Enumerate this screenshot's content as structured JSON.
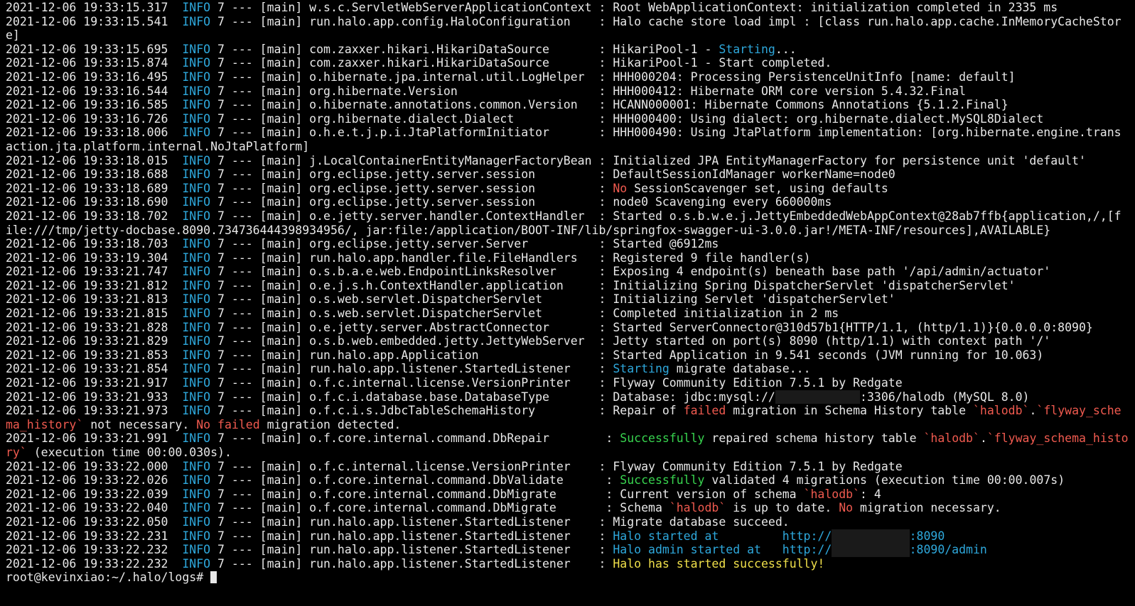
{
  "colors": {
    "background": "#000000",
    "text": "#e8e8e8",
    "info": "#2ea8dc",
    "error": "#f05a4f",
    "success": "#38d44f",
    "highlight": "#f0e04a"
  },
  "lines": [
    [
      {
        "t": "2021-12-06 19:33:15.317  "
      },
      {
        "t": "INFO",
        "c": "cyan"
      },
      {
        "t": " 7 --- [main] w.s.c.ServletWebServerApplicationContext : Root WebApplicationContext: initialization completed in 2335 ms"
      }
    ],
    [
      {
        "t": "2021-12-06 19:33:15.541  "
      },
      {
        "t": "INFO",
        "c": "cyan"
      },
      {
        "t": " 7 --- [main] run.halo.app.config.HaloConfiguration    : Halo cache store load impl : [class run.halo.app.cache.InMemoryCacheStor"
      }
    ],
    [
      {
        "t": "e]"
      }
    ],
    [
      {
        "t": "2021-12-06 19:33:15.695  "
      },
      {
        "t": "INFO",
        "c": "cyan"
      },
      {
        "t": " 7 --- [main] com.zaxxer.hikari.HikariDataSource       : HikariPool-1 - "
      },
      {
        "t": "Starting",
        "c": "cyan"
      },
      {
        "t": "..."
      }
    ],
    [
      {
        "t": "2021-12-06 19:33:15.874  "
      },
      {
        "t": "INFO",
        "c": "cyan"
      },
      {
        "t": " 7 --- [main] com.zaxxer.hikari.HikariDataSource       : HikariPool-1 - Start completed."
      }
    ],
    [
      {
        "t": "2021-12-06 19:33:16.495  "
      },
      {
        "t": "INFO",
        "c": "cyan"
      },
      {
        "t": " 7 --- [main] o.hibernate.jpa.internal.util.LogHelper  : HHH000204: Processing PersistenceUnitInfo [name: default]"
      }
    ],
    [
      {
        "t": "2021-12-06 19:33:16.544  "
      },
      {
        "t": "INFO",
        "c": "cyan"
      },
      {
        "t": " 7 --- [main] org.hibernate.Version                    : HHH000412: Hibernate ORM core version 5.4.32.Final"
      }
    ],
    [
      {
        "t": "2021-12-06 19:33:16.585  "
      },
      {
        "t": "INFO",
        "c": "cyan"
      },
      {
        "t": " 7 --- [main] o.hibernate.annotations.common.Version   : HCANN000001: Hibernate Commons Annotations {5.1.2.Final}"
      }
    ],
    [
      {
        "t": "2021-12-06 19:33:16.726  "
      },
      {
        "t": "INFO",
        "c": "cyan"
      },
      {
        "t": " 7 --- [main] org.hibernate.dialect.Dialect            : HHH000400: Using dialect: org.hibernate.dialect.MySQL8Dialect"
      }
    ],
    [
      {
        "t": "2021-12-06 19:33:18.006  "
      },
      {
        "t": "INFO",
        "c": "cyan"
      },
      {
        "t": " 7 --- [main] o.h.e.t.j.p.i.JtaPlatformInitiator       : HHH000490: Using JtaPlatform implementation: [org.hibernate.engine.trans"
      }
    ],
    [
      {
        "t": "action.jta.platform.internal.NoJtaPlatform]"
      }
    ],
    [
      {
        "t": "2021-12-06 19:33:18.015  "
      },
      {
        "t": "INFO",
        "c": "cyan"
      },
      {
        "t": " 7 --- [main] j.LocalContainerEntityManagerFactoryBean : Initialized JPA EntityManagerFactory for persistence unit 'default'"
      }
    ],
    [
      {
        "t": "2021-12-06 19:33:18.688  "
      },
      {
        "t": "INFO",
        "c": "cyan"
      },
      {
        "t": " 7 --- [main] org.eclipse.jetty.server.session         : DefaultSessionIdManager workerName=node0"
      }
    ],
    [
      {
        "t": "2021-12-06 19:33:18.689  "
      },
      {
        "t": "INFO",
        "c": "cyan"
      },
      {
        "t": " 7 --- [main] org.eclipse.jetty.server.session         : "
      },
      {
        "t": "No",
        "c": "red"
      },
      {
        "t": " SessionScavenger set, using defaults"
      }
    ],
    [
      {
        "t": "2021-12-06 19:33:18.690  "
      },
      {
        "t": "INFO",
        "c": "cyan"
      },
      {
        "t": " 7 --- [main] org.eclipse.jetty.server.session         : node0 Scavenging every 660000ms"
      }
    ],
    [
      {
        "t": "2021-12-06 19:33:18.702  "
      },
      {
        "t": "INFO",
        "c": "cyan"
      },
      {
        "t": " 7 --- [main] o.e.jetty.server.handler.ContextHandler  : Started o.s.b.w.e.j.JettyEmbeddedWebAppContext@28ab7ffb{application,/,[f"
      }
    ],
    [
      {
        "t": "ile:///tmp/jetty-docbase.8090.734736444398934956/, jar:file:/application/BOOT-INF/lib/springfox-swagger-ui-3.0.0.jar!/META-INF/resources],AVAILABLE}"
      }
    ],
    [
      {
        "t": "2021-12-06 19:33:18.703  "
      },
      {
        "t": "INFO",
        "c": "cyan"
      },
      {
        "t": " 7 --- [main] org.eclipse.jetty.server.Server          : Started @6912ms"
      }
    ],
    [
      {
        "t": "2021-12-06 19:33:19.304  "
      },
      {
        "t": "INFO",
        "c": "cyan"
      },
      {
        "t": " 7 --- [main] run.halo.app.handler.file.FileHandlers   : Registered 9 file handler(s)"
      }
    ],
    [
      {
        "t": "2021-12-06 19:33:21.747  "
      },
      {
        "t": "INFO",
        "c": "cyan"
      },
      {
        "t": " 7 --- [main] o.s.b.a.e.web.EndpointLinksResolver      : Exposing 4 endpoint(s) beneath base path '/api/admin/actuator'"
      }
    ],
    [
      {
        "t": "2021-12-06 19:33:21.812  "
      },
      {
        "t": "INFO",
        "c": "cyan"
      },
      {
        "t": " 7 --- [main] o.e.j.s.h.ContextHandler.application     : Initializing Spring DispatcherServlet 'dispatcherServlet'"
      }
    ],
    [
      {
        "t": "2021-12-06 19:33:21.813  "
      },
      {
        "t": "INFO",
        "c": "cyan"
      },
      {
        "t": " 7 --- [main] o.s.web.servlet.DispatcherServlet        : Initializing Servlet 'dispatcherServlet'"
      }
    ],
    [
      {
        "t": "2021-12-06 19:33:21.815  "
      },
      {
        "t": "INFO",
        "c": "cyan"
      },
      {
        "t": " 7 --- [main] o.s.web.servlet.DispatcherServlet        : Completed initialization in 2 ms"
      }
    ],
    [
      {
        "t": "2021-12-06 19:33:21.828  "
      },
      {
        "t": "INFO",
        "c": "cyan"
      },
      {
        "t": " 7 --- [main] o.e.jetty.server.AbstractConnector       : Started ServerConnector@310d57b1{HTTP/1.1, (http/1.1)}{0.0.0.0:8090}"
      }
    ],
    [
      {
        "t": "2021-12-06 19:33:21.829  "
      },
      {
        "t": "INFO",
        "c": "cyan"
      },
      {
        "t": " 7 --- [main] o.s.b.web.embedded.jetty.JettyWebServer  : Jetty started on port(s) 8090 (http/1.1) with context path '/'"
      }
    ],
    [
      {
        "t": "2021-12-06 19:33:21.853  "
      },
      {
        "t": "INFO",
        "c": "cyan"
      },
      {
        "t": " 7 --- [main] run.halo.app.Application                 : Started Application in 9.541 seconds (JVM running for 10.063)"
      }
    ],
    [
      {
        "t": "2021-12-06 19:33:21.854  "
      },
      {
        "t": "INFO",
        "c": "cyan"
      },
      {
        "t": " 7 --- [main] run.halo.app.listener.StartedListener    : "
      },
      {
        "t": "Starting",
        "c": "cyan"
      },
      {
        "t": " migrate database..."
      }
    ],
    [
      {
        "t": "2021-12-06 19:33:21.917  "
      },
      {
        "t": "INFO",
        "c": "cyan"
      },
      {
        "t": " 7 --- [main] o.f.c.internal.license.VersionPrinter    : Flyway Community Edition 7.5.1 by Redgate"
      }
    ],
    [
      {
        "t": "2021-12-06 19:33:21.933  "
      },
      {
        "t": "INFO",
        "c": "cyan"
      },
      {
        "t": " 7 --- [main] o.f.c.i.database.base.DatabaseType       : Database: jdbc:mysql://"
      },
      {
        "t": "xxxxxxxxxxxx",
        "c": "blur"
      },
      {
        "t": ":3306/halodb (MySQL 8.0)"
      }
    ],
    [
      {
        "t": "2021-12-06 19:33:21.973  "
      },
      {
        "t": "INFO",
        "c": "cyan"
      },
      {
        "t": " 7 --- [main] o.f.c.i.s.JdbcTableSchemaHistory         : Repair of "
      },
      {
        "t": "failed",
        "c": "red"
      },
      {
        "t": " migration in Schema History table "
      },
      {
        "t": "`halodb`",
        "c": "red"
      },
      {
        "t": "."
      },
      {
        "t": "`flyway_sche",
        "c": "red"
      }
    ],
    [
      {
        "t": "ma_history`",
        "c": "red"
      },
      {
        "t": " not necessary. "
      },
      {
        "t": "No",
        "c": "red"
      },
      {
        "t": " "
      },
      {
        "t": "failed",
        "c": "red"
      },
      {
        "t": " migration detected."
      }
    ],
    [
      {
        "t": "2021-12-06 19:33:21.991  "
      },
      {
        "t": "INFO",
        "c": "cyan"
      },
      {
        "t": " 7 --- [main] o.f.core.internal.command.DbRepair        : "
      },
      {
        "t": "Successfully",
        "c": "green"
      },
      {
        "t": " repaired schema history table "
      },
      {
        "t": "`halodb`",
        "c": "red"
      },
      {
        "t": "."
      },
      {
        "t": "`flyway_schema_histo",
        "c": "red"
      }
    ],
    [
      {
        "t": "ry`",
        "c": "red"
      },
      {
        "t": " (execution time 00:00.030s)."
      }
    ],
    [
      {
        "t": "2021-12-06 19:33:22.000  "
      },
      {
        "t": "INFO",
        "c": "cyan"
      },
      {
        "t": " 7 --- [main] o.f.c.internal.license.VersionPrinter    : Flyway Community Edition 7.5.1 by Redgate"
      }
    ],
    [
      {
        "t": "2021-12-06 19:33:22.026  "
      },
      {
        "t": "INFO",
        "c": "cyan"
      },
      {
        "t": " 7 --- [main] o.f.core.internal.command.DbValidate      : "
      },
      {
        "t": "Successfully",
        "c": "green"
      },
      {
        "t": " validated 4 migrations (execution time 00:00.007s)"
      }
    ],
    [
      {
        "t": "2021-12-06 19:33:22.039  "
      },
      {
        "t": "INFO",
        "c": "cyan"
      },
      {
        "t": " 7 --- [main] o.f.core.internal.command.DbMigrate       : Current version of schema "
      },
      {
        "t": "`halodb`",
        "c": "red"
      },
      {
        "t": ": 4"
      }
    ],
    [
      {
        "t": "2021-12-06 19:33:22.040  "
      },
      {
        "t": "INFO",
        "c": "cyan"
      },
      {
        "t": " 7 --- [main] o.f.core.internal.command.DbMigrate       : Schema "
      },
      {
        "t": "`halodb`",
        "c": "red"
      },
      {
        "t": " is up to date. "
      },
      {
        "t": "No",
        "c": "red"
      },
      {
        "t": " migration necessary."
      }
    ],
    [
      {
        "t": "2021-12-06 19:33:22.050  "
      },
      {
        "t": "INFO",
        "c": "cyan"
      },
      {
        "t": " 7 --- [main] run.halo.app.listener.StartedListener    : Migrate database succeed."
      }
    ],
    [
      {
        "t": "2021-12-06 19:33:22.231  "
      },
      {
        "t": "INFO",
        "c": "cyan"
      },
      {
        "t": " 7 --- [main] run.halo.app.listener.StartedListener    : "
      },
      {
        "t": "Halo started at         http://",
        "c": "cyan"
      },
      {
        "t": "xxxxxxxxxxx",
        "c": "blur"
      },
      {
        "t": ":8090",
        "c": "cyan"
      }
    ],
    [
      {
        "t": "2021-12-06 19:33:22.232  "
      },
      {
        "t": "INFO",
        "c": "cyan"
      },
      {
        "t": " 7 --- [main] run.halo.app.listener.StartedListener    : "
      },
      {
        "t": "Halo admin started at   http://",
        "c": "cyan"
      },
      {
        "t": "xxxxxxxxxxx",
        "c": "blur"
      },
      {
        "t": ":8090/admin",
        "c": "cyan"
      }
    ],
    [
      {
        "t": "2021-12-06 19:33:22.232  "
      },
      {
        "t": "INFO",
        "c": "cyan"
      },
      {
        "t": " 7 --- [main] run.halo.app.listener.StartedListener    : "
      },
      {
        "t": "Halo has started successfully!",
        "c": "yellow"
      }
    ]
  ],
  "prompt": "root@kevinxiao:~/.halo/logs# "
}
